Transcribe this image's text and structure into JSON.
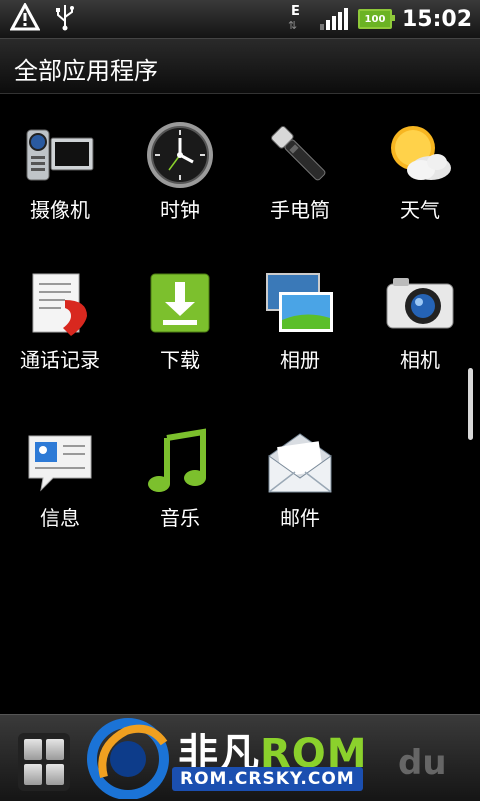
{
  "status_bar": {
    "network_type": "E",
    "battery_level": "100",
    "time": "15:02",
    "colors": {
      "battery": "#6bb324"
    }
  },
  "title_bar": {
    "title": "全部应用程序"
  },
  "apps": [
    {
      "label": "摄像机",
      "icon": "camcorder-icon"
    },
    {
      "label": "时钟",
      "icon": "clock-icon"
    },
    {
      "label": "手电筒",
      "icon": "flashlight-icon"
    },
    {
      "label": "天气",
      "icon": "weather-icon"
    },
    {
      "label": "通话记录",
      "icon": "call-log-icon"
    },
    {
      "label": "下载",
      "icon": "download-icon"
    },
    {
      "label": "相册",
      "icon": "gallery-icon"
    },
    {
      "label": "相机",
      "icon": "camera-icon"
    },
    {
      "label": "信息",
      "icon": "messages-icon"
    },
    {
      "label": "音乐",
      "icon": "music-icon"
    },
    {
      "label": "邮件",
      "icon": "mail-icon"
    }
  ],
  "watermark": {
    "brand_cn": "非凡",
    "brand_rom": "ROM",
    "url": "ROM.CRSKY.COM",
    "suffix": "du"
  }
}
